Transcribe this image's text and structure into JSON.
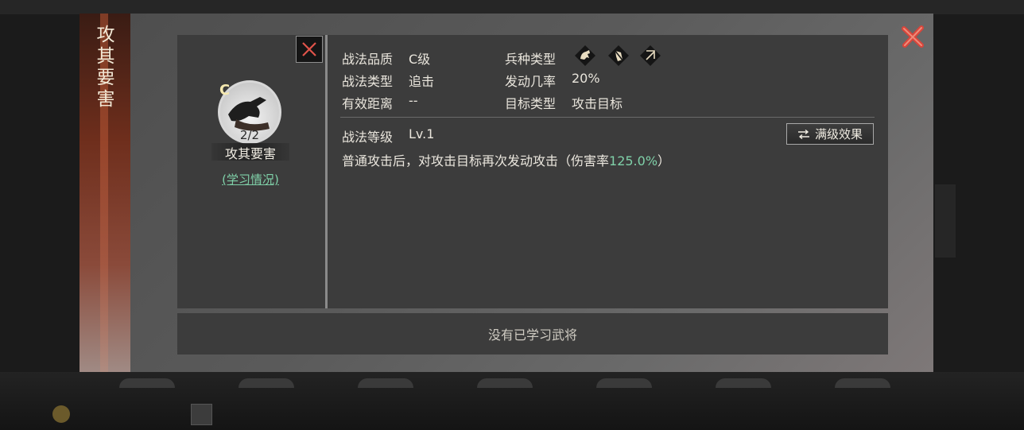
{
  "modal": {
    "title": "攻其要害",
    "skill": {
      "grade_mark": "C",
      "count": "2/2",
      "name": "攻其要害",
      "learn_link": "(学习情况)"
    },
    "info": {
      "quality_label": "战法品质",
      "quality_value": "C级",
      "type_label": "战法类型",
      "type_value": "追击",
      "range_label": "有效距离",
      "range_value": "--",
      "troop_label": "兵种类型",
      "troop_icons": [
        "cavalry-icon",
        "shield-icon",
        "bow-icon"
      ],
      "rate_label": "发动几率",
      "rate_value": "20%",
      "target_label": "目标类型",
      "target_value": "攻击目标",
      "level_label": "战法等级",
      "level_value": "Lv.1",
      "full_level_button": "满级效果",
      "description_prefix": "普通攻击后，对攻击目标再次发动攻击（伤害率",
      "description_value": "125.0%",
      "description_suffix": "）"
    },
    "learned_status": "没有已学习武将"
  },
  "colors": {
    "accent_green": "#7fd0a8",
    "close_red": "#d9453b",
    "title_strip": "#6e2e1c"
  }
}
